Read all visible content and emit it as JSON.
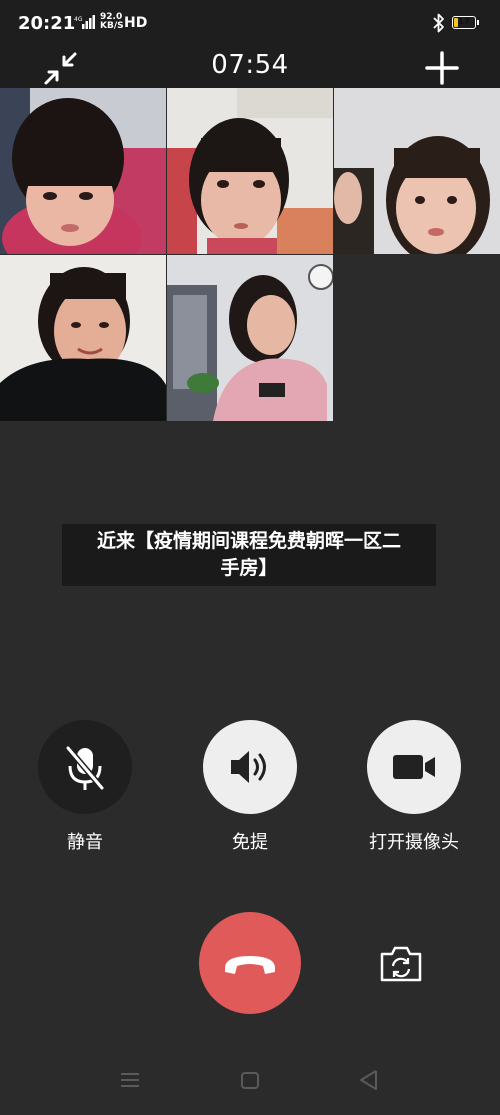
{
  "status_bar": {
    "time": "20:21",
    "signal_label": "4G",
    "speed_value": "92.0",
    "speed_unit": "KB/S",
    "hd": "HD",
    "battery": "17",
    "battery_level": 0.17
  },
  "call": {
    "timer": "07:54"
  },
  "participants": [
    {
      "name": "participant-1"
    },
    {
      "name": "participant-2"
    },
    {
      "name": "participant-3"
    },
    {
      "name": "participant-4"
    },
    {
      "name": "participant-5"
    }
  ],
  "banner": {
    "line1": "近来【疫情期间课程免费朝晖一区二",
    "line2": "手房】"
  },
  "controls": {
    "mute_label": "静音",
    "speaker_label": "免提",
    "camera_label": "打开摄像头"
  },
  "colors": {
    "background": "#2b2b2b",
    "hangup": "#e05a5a",
    "control_light": "#eeeeee",
    "control_dark": "#1f1f1f",
    "battery": "#f5c518"
  },
  "icons": {
    "minimize": "minimize-arrows-icon",
    "add": "plus-icon",
    "mute": "mic-off-icon",
    "speaker": "speaker-icon",
    "camera": "video-camera-icon",
    "hangup": "phone-hangup-icon",
    "switch_camera": "switch-camera-icon",
    "nav_menu": "menu-icon",
    "nav_home": "home-icon",
    "nav_back": "back-icon"
  }
}
